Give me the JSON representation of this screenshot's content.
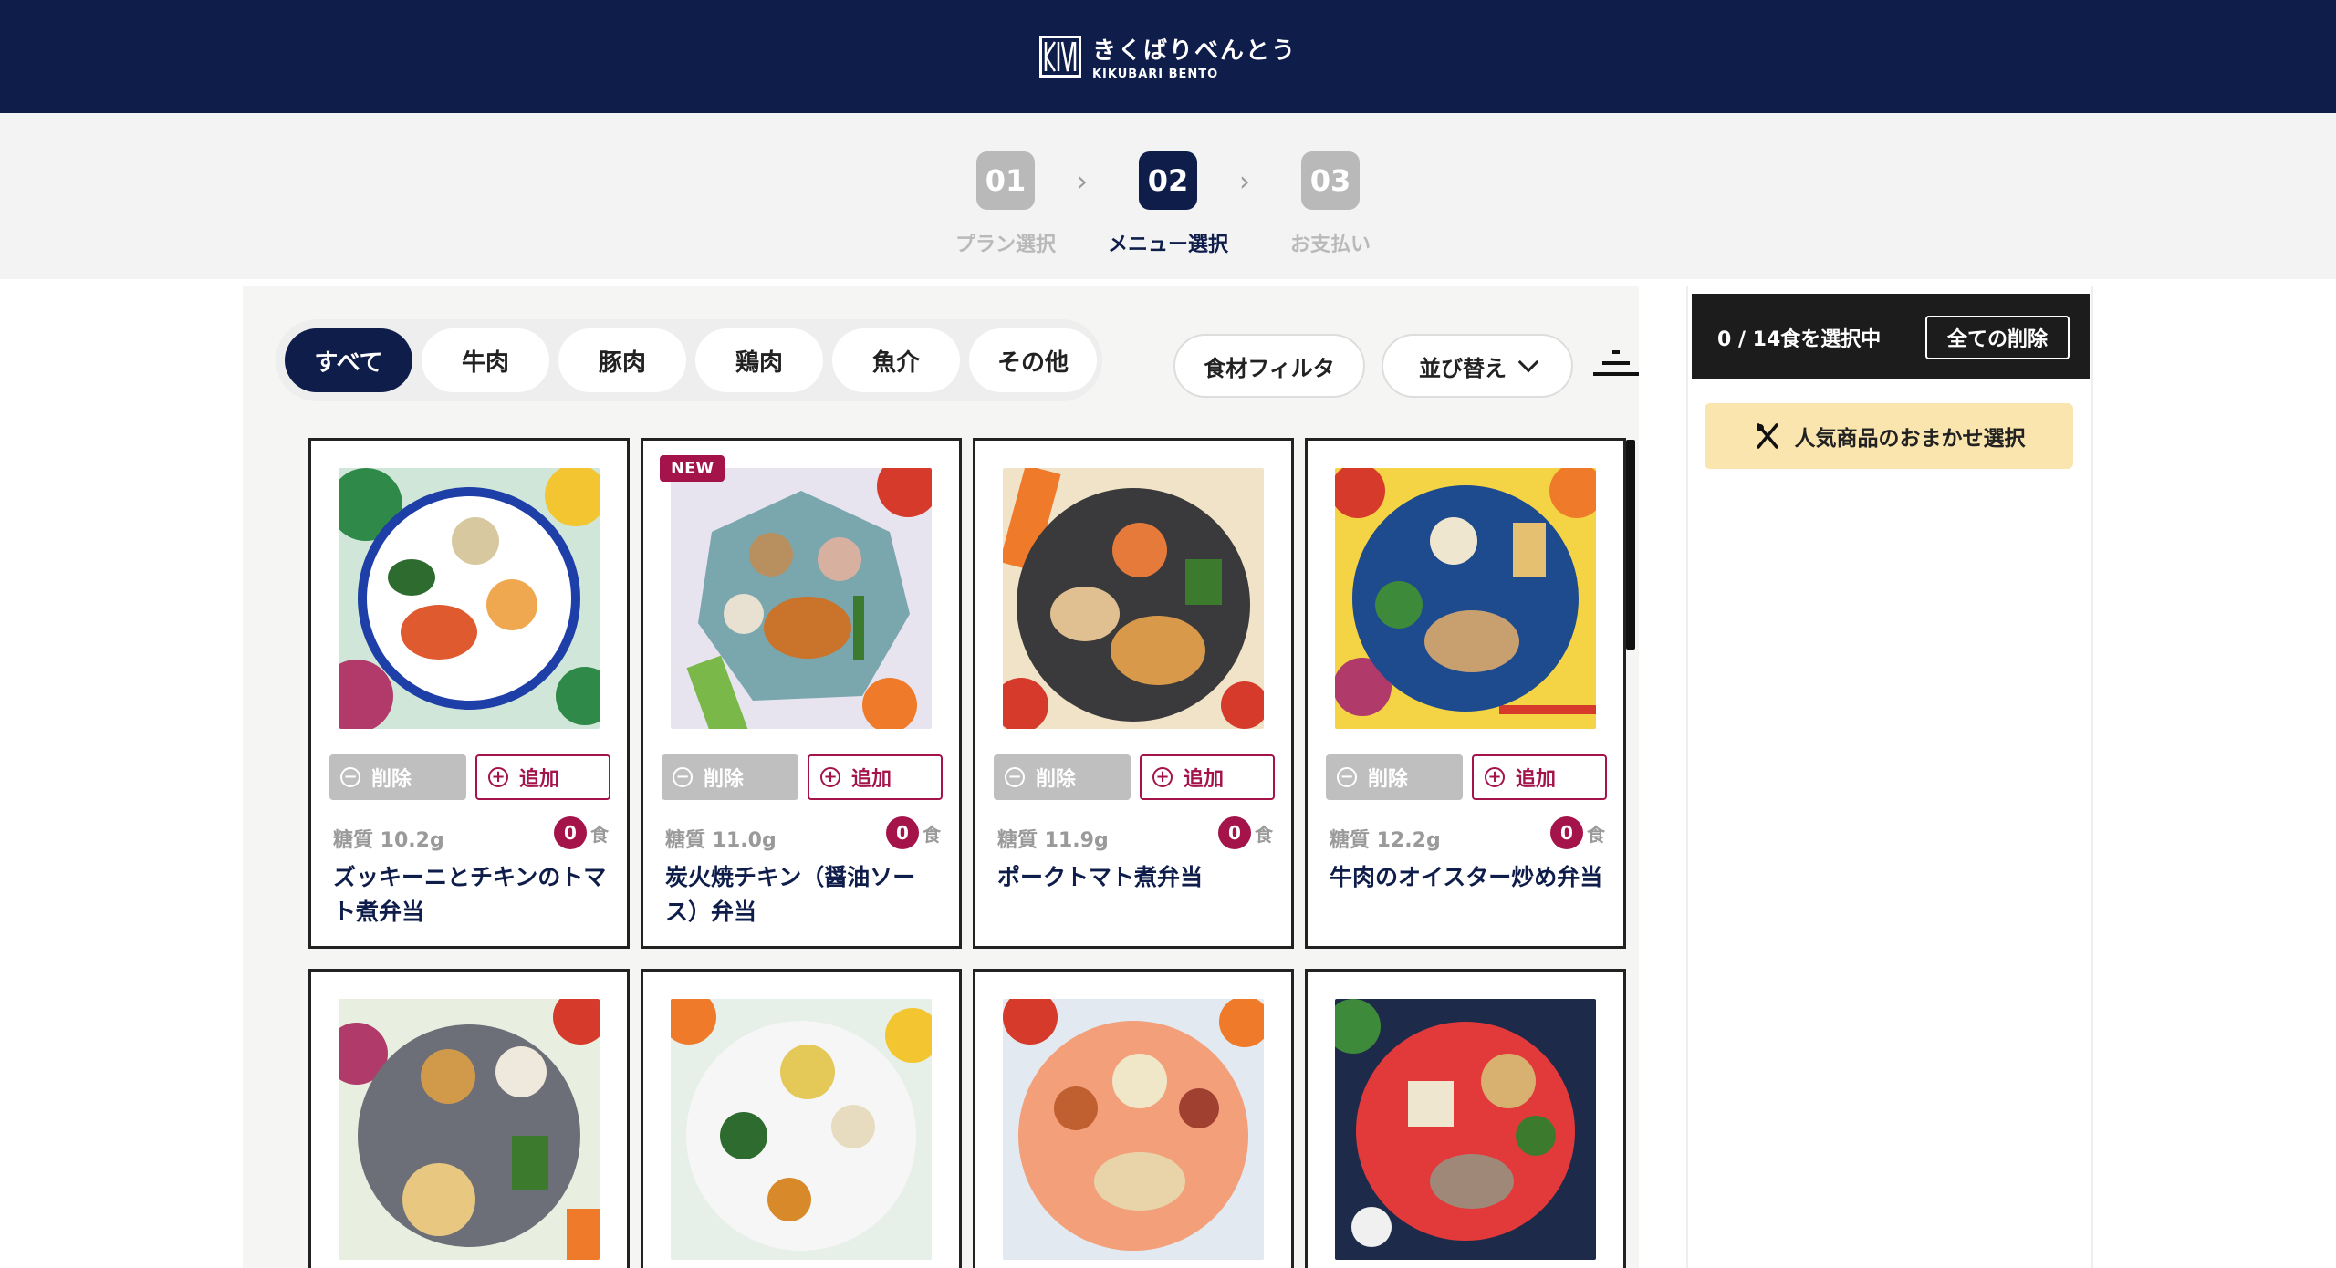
{
  "header": {
    "logo_mark": "KIKU",
    "logo_jp": "きくばりべんとう",
    "logo_en": "KIKUBARI BENTO"
  },
  "steps": [
    {
      "num": "01",
      "label": "プラン選択"
    },
    {
      "num": "02",
      "label": "メニュー選択"
    },
    {
      "num": "03",
      "label": "お支払い"
    }
  ],
  "tabs": [
    "すべて",
    "牛肉",
    "豚肉",
    "鶏肉",
    "魚介",
    "その他"
  ],
  "filters": {
    "ingredient": "食材フィルタ",
    "sort": "並び替え"
  },
  "card_buttons": {
    "delete": "削除",
    "add": "追加",
    "unit": "食"
  },
  "products": [
    {
      "name": "ズッキーニとチキンのトマト煮弁当",
      "sugar": "糖質 10.2g",
      "qty": "0",
      "badge": ""
    },
    {
      "name": "炭火焼チキン（醤油ソース）弁当",
      "sugar": "糖質 11.0g",
      "qty": "0",
      "badge": "NEW"
    },
    {
      "name": "ポークトマト煮弁当",
      "sugar": "糖質 11.9g",
      "qty": "0",
      "badge": ""
    },
    {
      "name": "牛肉のオイスター炒め弁当",
      "sugar": "糖質 12.2g",
      "qty": "0",
      "badge": ""
    }
  ],
  "side": {
    "selected": "0 / 14食を選択中",
    "clear_all": "全ての削除",
    "omakase": "人気商品のおまかせ選択"
  },
  "colors": {
    "navy": "#0f1d4a",
    "accent": "#a4134a",
    "omakase_bg": "#fbe5ae"
  }
}
